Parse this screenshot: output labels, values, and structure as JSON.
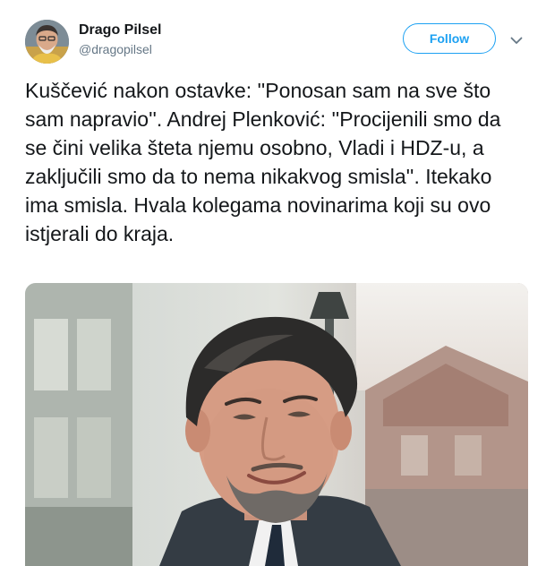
{
  "author": {
    "name": "Drago Pilsel",
    "handle": "@dragopilsel"
  },
  "actions": {
    "follow_label": "Follow",
    "menu_icon": "chevron-down-icon"
  },
  "tweet": {
    "text": "Kuščević nakon ostavke: ''Ponosan sam na sve što sam napravio''. Andrej Plenković: ''Procijenili smo da se čini velika šteta njemu osobno, Vladi i HDZ-u, a zaključili smo da to nema nikakvog smisla''. Itekako ima smisla. Hvala kolegama novinarima koji su ovo istjerali do kraja."
  },
  "colors": {
    "accent": "#1da1f2",
    "handle": "#657786",
    "text": "#14171a"
  }
}
